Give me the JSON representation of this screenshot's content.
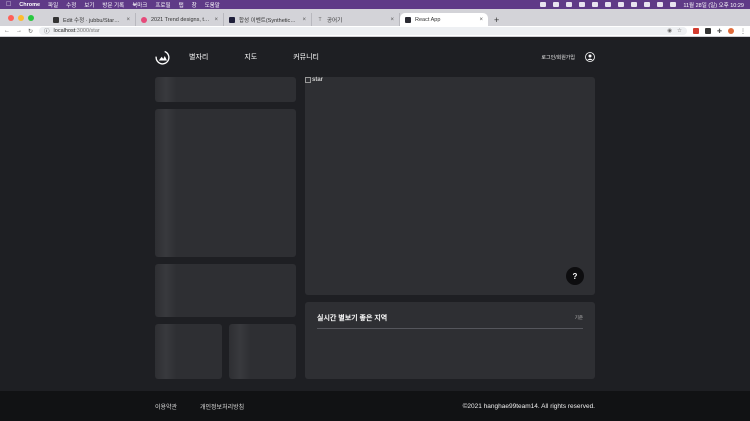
{
  "menubar": {
    "app": "Chrome",
    "items": [
      "파일",
      "수정",
      "보기",
      "방문 기록",
      "북마크",
      "프로필",
      "탭",
      "창",
      "도움말"
    ],
    "clock": "11월 28일 (일) 오후 10:29"
  },
  "tabs": [
    {
      "title": "Edit 수정 · jubbu/StarProject · Gi",
      "fav_color": "#333333"
    },
    {
      "title": "2021 Trend designs, themes, templ",
      "fav_color": "#e64a7a"
    },
    {
      "title": "합성 이벤트(SyntheticEvent) – R",
      "fav_color": "#1f1f3a"
    },
    {
      "title": "공어기",
      "fav_color": "#888888"
    },
    {
      "title": "React App",
      "fav_color": "#2b2b33",
      "active": true
    }
  ],
  "address": {
    "host": "localhost",
    "path": ":3000/star"
  },
  "site": {
    "nav": [
      "별자리",
      "지도",
      "커뮤니티"
    ],
    "login": "로그인/회원가입",
    "image_alt": "star",
    "help": "?",
    "recommend": {
      "title": "실시간 별보기 좋은 지역",
      "criteria": "기준"
    },
    "footer": {
      "terms": "이용약관",
      "privacy": "개인정보처리방침",
      "copyright": "©2021 hanghae99team14. All rights reserved."
    }
  },
  "colors": {
    "menubar": "#5f3a87",
    "page_bg": "#1e1f23",
    "card": "#2e2f33",
    "footer": "#111214"
  }
}
